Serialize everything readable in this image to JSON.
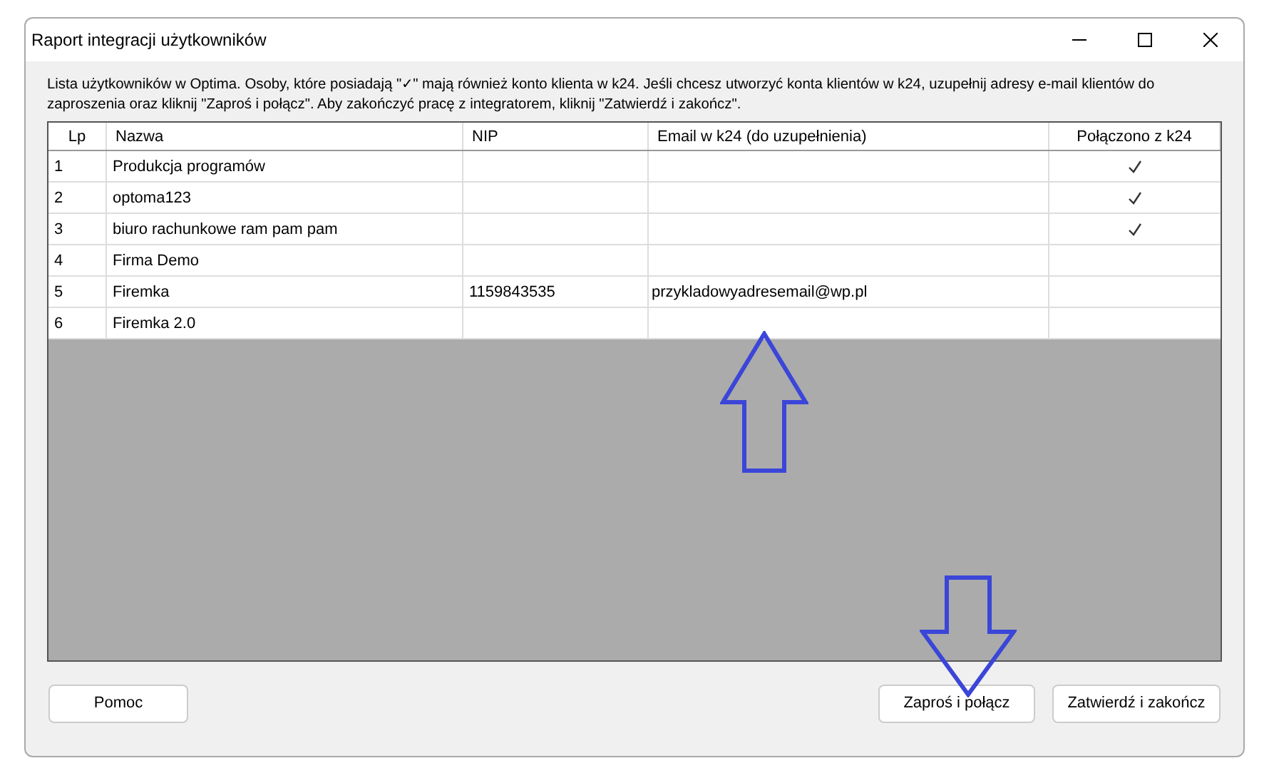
{
  "window": {
    "title": "Raport integracji użytkowników"
  },
  "intro": "Lista użytkowników w Optima. Osoby, które posiadają \"✓\" mają również konto klienta w k24. Jeśli chcesz utworzyć konta klientów w k24, uzupełnij adresy e-mail klientów do zaproszenia oraz kliknij \"Zaproś i połącz\". Aby zakończyć pracę z integratorem, kliknij \"Zatwierdź i zakończ\".",
  "table": {
    "columns": [
      "Lp",
      "Nazwa",
      "NIP",
      "Email w k24 (do uzupełnienia)",
      "Połączono z k24"
    ],
    "rows": [
      {
        "lp": "1",
        "name": "Produkcja programów",
        "connected": true
      },
      {
        "lp": "2",
        "name": "optoma123",
        "connected": true
      },
      {
        "lp": "3",
        "name": "biuro rachunkowe ram pam pam",
        "connected": true
      },
      {
        "lp": "4",
        "name": "Firma Demo",
        "connected": false
      },
      {
        "lp": "5",
        "name": "Firemka",
        "nip": "1159843535",
        "email": "przykladowyadresemail@wp.pl",
        "connected": false
      },
      {
        "lp": "6",
        "name": "Firemka 2.0",
        "connected": false
      }
    ]
  },
  "buttons": {
    "help": "Pomoc",
    "invite": "Zaproś i połącz",
    "confirm": "Zatwierdź i zakończ"
  }
}
